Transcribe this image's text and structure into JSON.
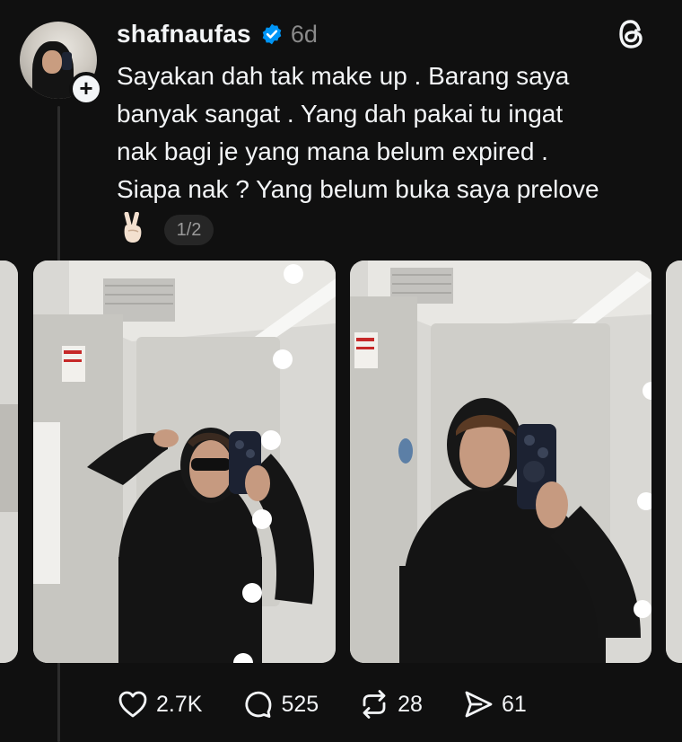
{
  "post": {
    "username": "shafnaufas",
    "time": "6d",
    "text": "Sayakan dah tak make up . Barang saya\nbanyak sangat . Yang dah pakai tu ingat\nnak bagi je yang mana belum expired .\nSiapa nak ? Yang belum buka saya prelove",
    "emoji": "✌🏻",
    "page_indicator": "1/2",
    "images": [
      "mirror-selfie-sunglasses",
      "mirror-selfie"
    ]
  },
  "actions": {
    "likes": "2.7K",
    "replies": "525",
    "reposts": "28",
    "shares": "61"
  },
  "icons": [
    "verified-badge-icon",
    "threads-logo-icon",
    "heart-icon",
    "comment-icon",
    "repost-icon",
    "share-icon"
  ],
  "colors": {
    "background": "#101010",
    "text": "#f3f5f7",
    "muted": "#8a8a8a",
    "verified": "#0095f6"
  }
}
